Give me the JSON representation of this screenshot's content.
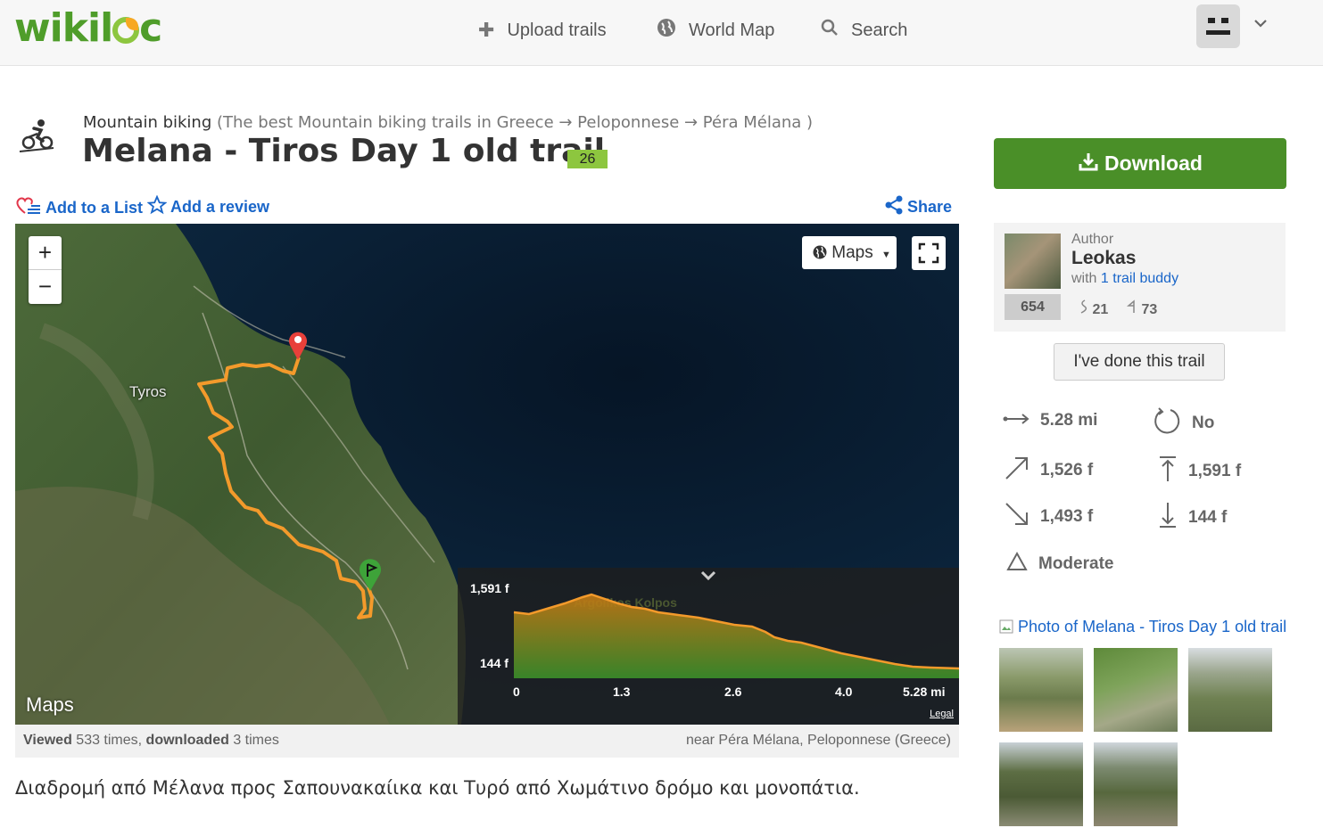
{
  "header": {
    "logo": "wikiloc",
    "nav": [
      {
        "icon": "plus-icon",
        "label": "Upload trails"
      },
      {
        "icon": "globe-icon",
        "label": "World Map"
      },
      {
        "icon": "search-icon",
        "label": "Search"
      }
    ]
  },
  "trail": {
    "activity": "Mountain biking",
    "breadcrumb": "(The best Mountain biking trails in Greece → Peloponnese → Péra Mélana )",
    "title": "Melana - Tiros Day 1 old trail",
    "badge": "26",
    "actions": {
      "add_list": "Add to a List",
      "add_review": "Add a review",
      "share": "Share"
    }
  },
  "map": {
    "zoom_in": "+",
    "zoom_out": "−",
    "layer_button": "Maps",
    "place_label": "Tyros",
    "sea_label": "Argolikos Kolpos",
    "brand": "Maps",
    "legal": "Legal",
    "elevation": {
      "y_max": "1,591 f",
      "y_min": "144 f",
      "x_ticks": [
        "0",
        "1.3",
        "2.6",
        "4.0",
        "5.28 mi"
      ]
    }
  },
  "stats_bar": {
    "viewed_label": "Viewed",
    "viewed_count": " 533 times, ",
    "downloaded_label": "downloaded",
    "downloaded_count": " 3 times",
    "location": "near Péra Mélana, Peloponnese (Greece)"
  },
  "description": "Διαδρομή από Μέλανα προς Σαπουνακαίικα και Τυρό από Χωμάτινο δρόμο και μονοπάτια.",
  "sidebar": {
    "download": "Download",
    "author": {
      "label": "Author",
      "name": "Leokas",
      "with_prefix": "with ",
      "buddies": "1 trail buddy",
      "rank": "654",
      "trails": "21",
      "followers": "73"
    },
    "done_button": "I've done this trail",
    "stats": {
      "distance": "5.28 mi",
      "loop": "No",
      "elev_gain": "1,526 f",
      "max_elev": "1,591 f",
      "elev_loss": "1,493 f",
      "min_elev": "144 f",
      "difficulty": "Moderate"
    },
    "photo_title": "Photo of Melana - Tiros Day 1 old trail"
  },
  "colors": {
    "brand_green": "#4a8f28",
    "link_blue": "#1a66c9",
    "track_orange": "#f39a2b"
  }
}
